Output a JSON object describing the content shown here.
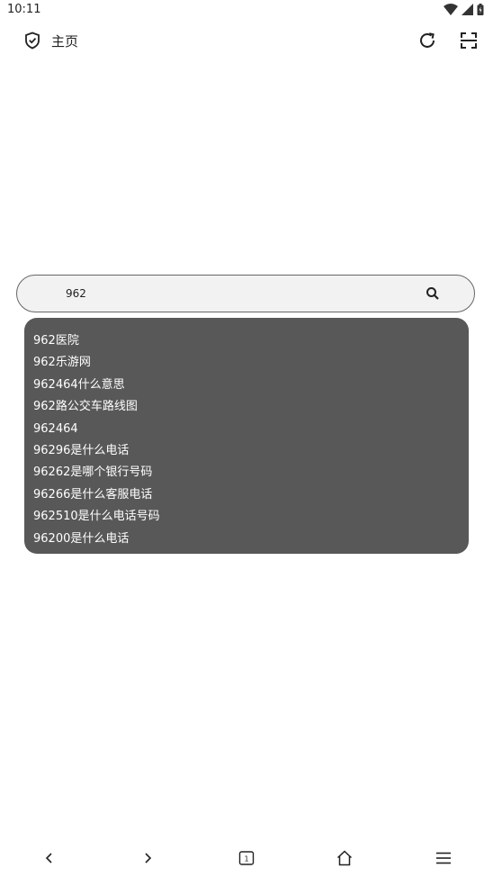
{
  "status_bar": {
    "time": "10:11"
  },
  "top_bar": {
    "title": "主页"
  },
  "search": {
    "value": "962"
  },
  "suggestions": [
    "962医院",
    "962乐游网",
    "962464什么意思",
    "962路公交车路线图",
    "962464",
    "96296是什么电话",
    "96262是哪个银行号码",
    "96266是什么客服电话",
    "962510是什么电话号码",
    "96200是什么电话"
  ],
  "bottom_nav": {
    "tab_count": "1"
  }
}
